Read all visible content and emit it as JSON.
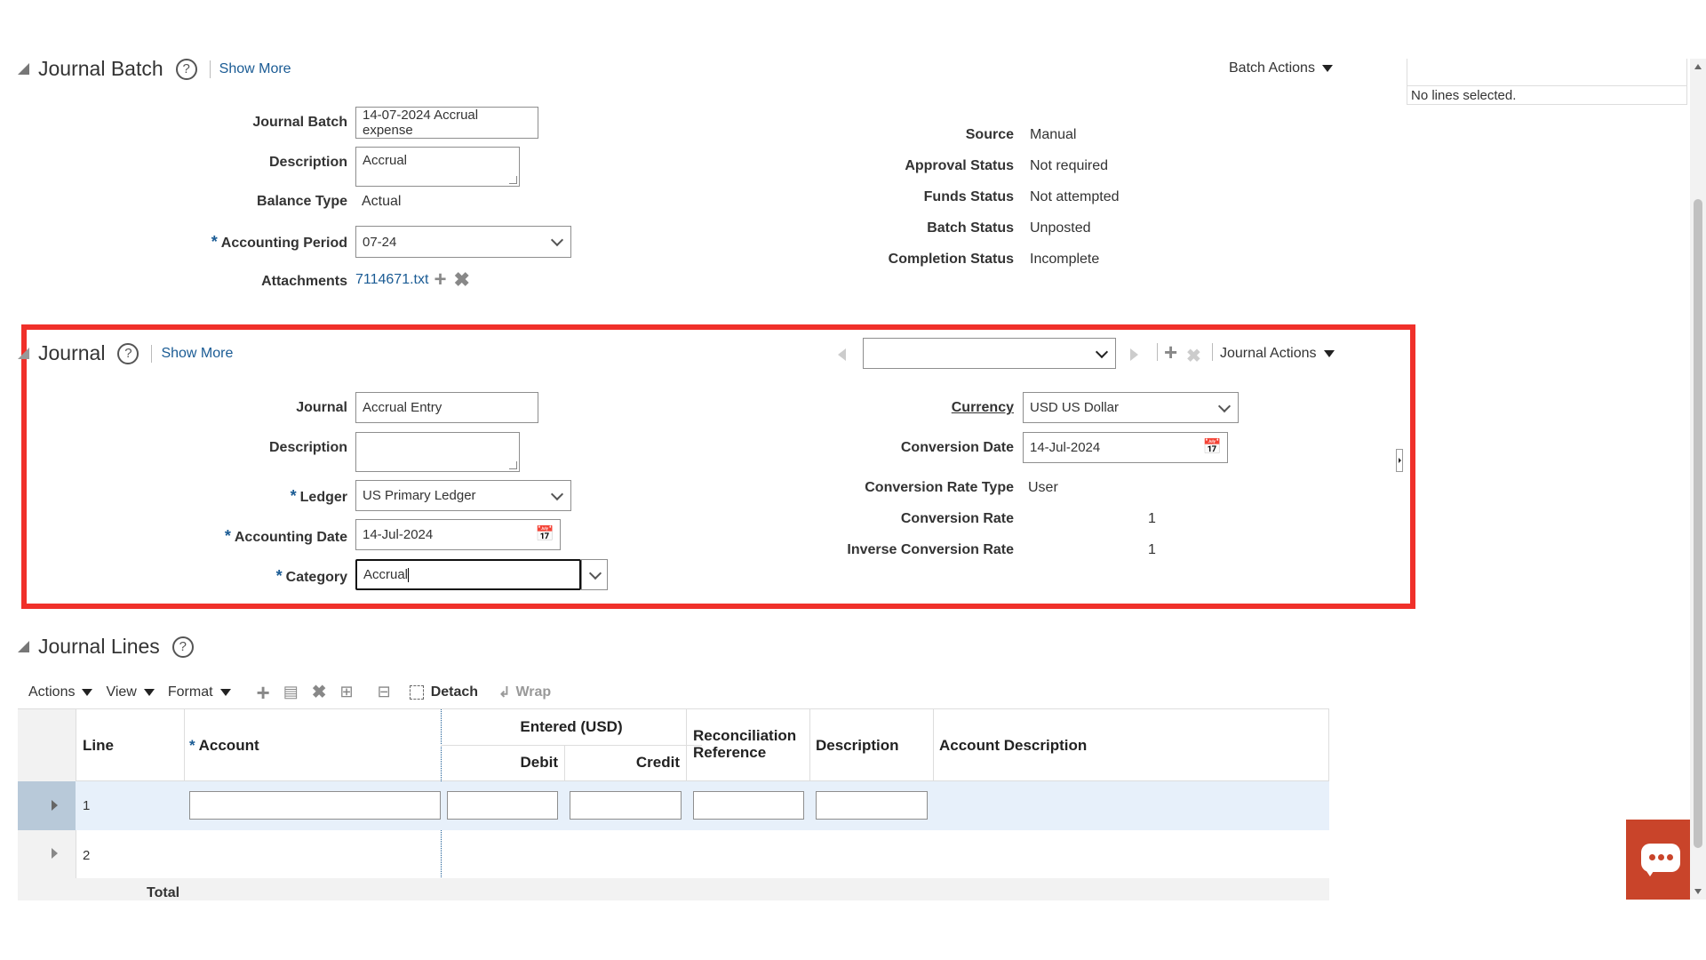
{
  "batch": {
    "title": "Journal Batch",
    "show_more": "Show More",
    "actions": "Batch Actions",
    "fields": {
      "journal_batch_label": "Journal Batch",
      "journal_batch_value": "14-07-2024 Accrual expense",
      "description_label": "Description",
      "description_value": "Accrual",
      "balance_type_label": "Balance Type",
      "balance_type_value": "Actual",
      "accounting_period_label": "Accounting Period",
      "accounting_period_value": "07-24",
      "attachments_label": "Attachments",
      "attachments_value": "7114671.txt"
    },
    "status": {
      "source_label": "Source",
      "source_value": "Manual",
      "approval_label": "Approval Status",
      "approval_value": "Not required",
      "funds_label": "Funds Status",
      "funds_value": "Not attempted",
      "batch_status_label": "Batch Status",
      "batch_status_value": "Unposted",
      "completion_label": "Completion Status",
      "completion_value": "Incomplete"
    }
  },
  "side_panel": {
    "message": "No lines selected."
  },
  "journal": {
    "title": "Journal",
    "show_more": "Show More",
    "actions": "Journal Actions",
    "selector_value": "",
    "fields": {
      "journal_label": "Journal",
      "journal_value": "Accrual Entry",
      "description_label": "Description",
      "description_value": "",
      "ledger_label": "Ledger",
      "ledger_value": "US Primary Ledger",
      "accounting_date_label": "Accounting Date",
      "accounting_date_value": "14-Jul-2024",
      "category_label": "Category",
      "category_value": "Accrual"
    },
    "currency": {
      "currency_label": "Currency",
      "currency_value": "USD US Dollar",
      "conversion_date_label": "Conversion Date",
      "conversion_date_value": "14-Jul-2024",
      "rate_type_label": "Conversion Rate Type",
      "rate_type_value": "User",
      "rate_label": "Conversion Rate",
      "rate_value": "1",
      "inverse_label": "Inverse Conversion Rate",
      "inverse_value": "1"
    }
  },
  "lines": {
    "title": "Journal Lines",
    "toolbar": {
      "actions": "Actions",
      "view": "View",
      "format": "Format",
      "detach": "Detach",
      "wrap": "Wrap"
    },
    "columns": {
      "line": "Line",
      "account": "Account",
      "entered": "Entered (USD)",
      "debit": "Debit",
      "credit": "Credit",
      "recon": "Reconciliation Reference",
      "description": "Description",
      "account_description": "Account Description"
    },
    "rows": [
      "1",
      "2"
    ],
    "total": "Total"
  },
  "colors": {
    "highlight_border": "#f0302a",
    "selected_row": "#e7f0fa",
    "chat": "#c9442a",
    "link": "#1a5b94"
  }
}
